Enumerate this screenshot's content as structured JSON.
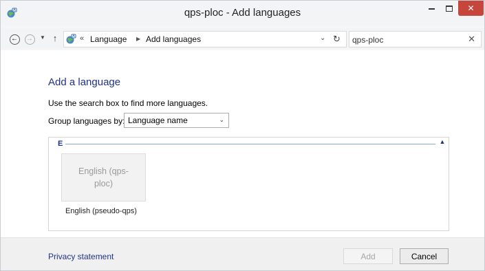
{
  "window": {
    "title": "qps-ploc - Add languages",
    "close_glyph": "✕"
  },
  "nav": {
    "back_glyph": "←",
    "forward_glyph": "→",
    "recent_glyph": "▼",
    "up_glyph": "↑",
    "overflow_glyph": "«",
    "breadcrumb": [
      "Language",
      "Add languages"
    ],
    "separator_glyph": "▶",
    "dropdown_glyph": "⌄",
    "refresh_glyph": "↻",
    "search_value": "qps-ploc",
    "clear_glyph": "✕"
  },
  "content": {
    "title": "Add a language",
    "instruction": "Use the search box to find more languages.",
    "group_by_label": "Group languages by:",
    "group_by_value": "Language name",
    "group_by_arrow": "⌄",
    "group_letter": "E",
    "collapse_glyph": "▲",
    "languages": [
      {
        "tile_label": "English (qps-ploc)",
        "caption": "English (pseudo-qps)"
      }
    ]
  },
  "footer": {
    "privacy_link": "Privacy statement",
    "add_label": "Add",
    "cancel_label": "Cancel"
  },
  "colors": {
    "accent": "#1e3287",
    "close_button": "#c7463c",
    "footer_bg": "#f0f0f0"
  },
  "icons": {
    "app": "language-globe-icon",
    "address": "language-globe-icon"
  }
}
